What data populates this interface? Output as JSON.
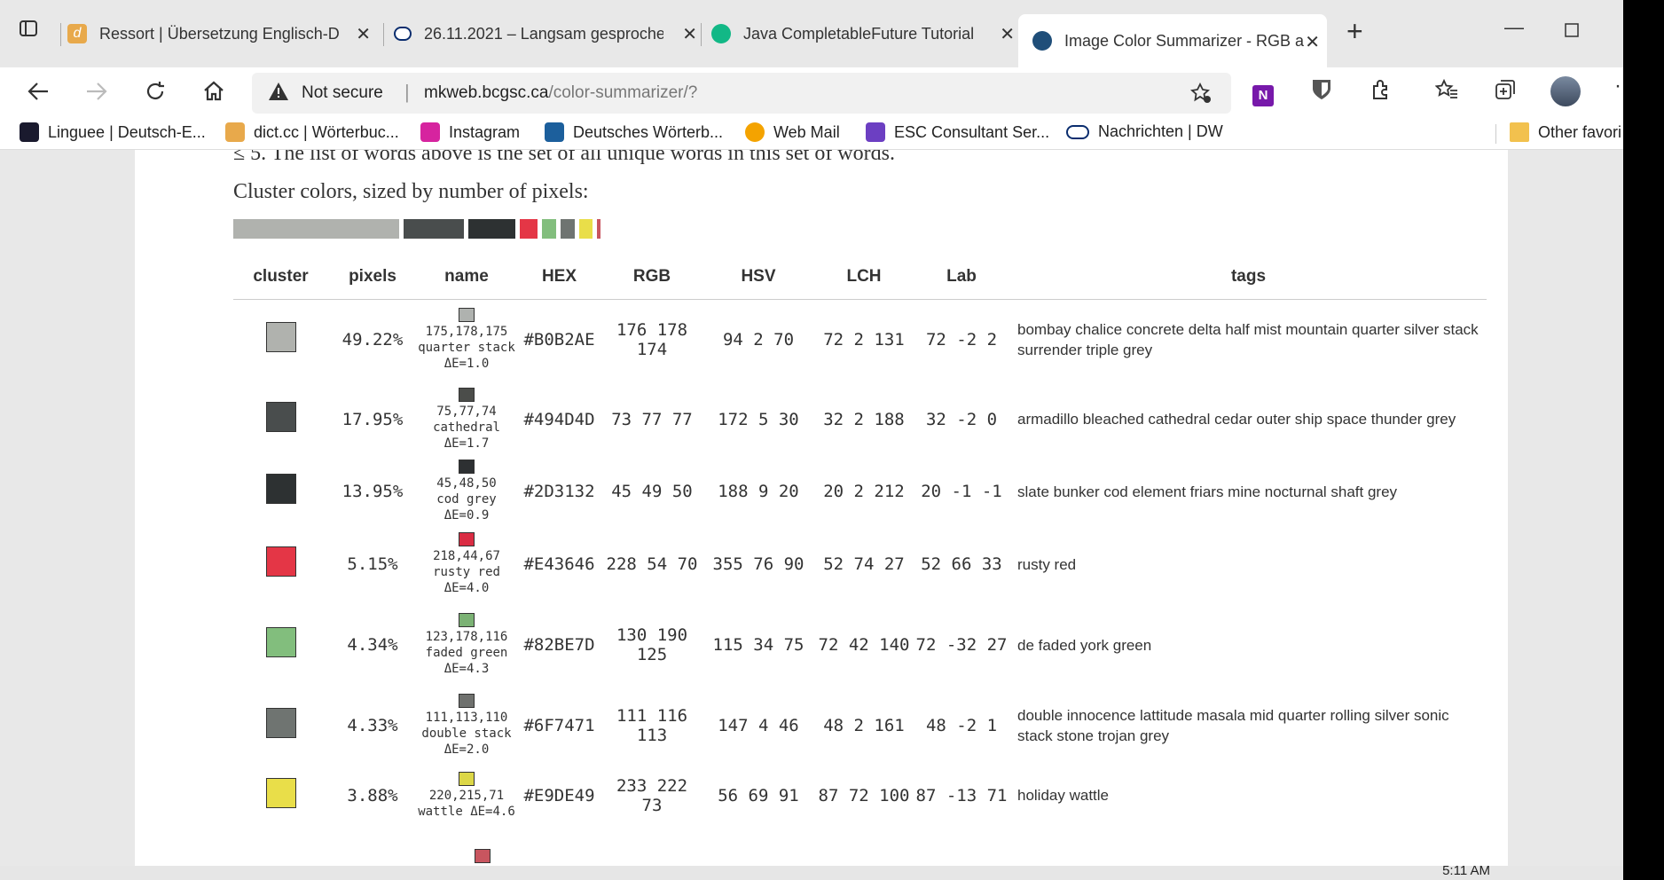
{
  "browser": {
    "tabs": [
      {
        "label": "Ressort | Übersetzung Englisch-D",
        "icon": "dictcc-icon",
        "color": "#e8a94b"
      },
      {
        "label": "26.11.2021 – Langsam gesproche",
        "icon": "dw-icon",
        "color": "#0a2d6e"
      },
      {
        "label": "Java CompletableFuture Tutorial",
        "icon": "grammarly-icon",
        "color": "#12b886"
      },
      {
        "label": "Image Color Summarizer - RGB a",
        "icon": "site-icon",
        "color": "#1f4e79"
      }
    ],
    "address": {
      "security": "Not secure",
      "host": "mkweb.bcgsc.ca",
      "path": "/color-summarizer/?"
    },
    "bookmarks": [
      {
        "label": "Linguee | Deutsch-E...",
        "icon": "linguee-icon",
        "color": "#1a1a2e"
      },
      {
        "label": "dict.cc | Wörterbuc...",
        "icon": "dictcc-icon",
        "color": "#e8a94b"
      },
      {
        "label": "Instagram",
        "icon": "instagram-icon",
        "color": "#d6249f"
      },
      {
        "label": "Deutsches Wörterb...",
        "icon": "dwds-icon",
        "color": "#1c5f9c"
      },
      {
        "label": "Web Mail",
        "icon": "webmail-icon",
        "color": "#f4a300"
      },
      {
        "label": "ESC Consultant Ser...",
        "icon": "form-icon",
        "color": "#6c3fc2"
      },
      {
        "label": "Nachrichten | DW",
        "icon": "dw-icon",
        "color": "#0a2d6e"
      }
    ],
    "other_favorites": "Other favori"
  },
  "page": {
    "intro": "≤ 5. The list of words above is the set of all unique words in this set of words.",
    "cluster_title": "Cluster colors, sized by number of pixels:",
    "cluster_bars": [
      {
        "color": "#B0B2AE",
        "share": 49.22
      },
      {
        "color": "#494D4D",
        "share": 17.95
      },
      {
        "color": "#2D3132",
        "share": 13.95
      },
      {
        "color": "#E43646",
        "share": 5.15
      },
      {
        "color": "#82BE7D",
        "share": 4.34
      },
      {
        "color": "#6F7471",
        "share": 4.33
      },
      {
        "color": "#E9DE49",
        "share": 3.88
      },
      {
        "color": "#C8555F",
        "share": 1.0
      }
    ],
    "table": {
      "headers": [
        "cluster",
        "pixels",
        "name",
        "HEX",
        "RGB",
        "HSV",
        "LCH",
        "Lab",
        "tags"
      ],
      "rows": [
        {
          "color": "#B0B2AE",
          "pixels": "49.22%",
          "name_rgb": "175,178,175",
          "name_text": "quarter stack",
          "delta": "ΔE=1.0",
          "name_color": "#AFB2AF",
          "hex": "#B0B2AE",
          "rgb": "176 178 174",
          "hsv": "94 2 70",
          "lch": "72 2 131",
          "lab": "72 -2 2",
          "tags": "bombay chalice concrete delta half mist mountain quarter silver stack surrender triple grey"
        },
        {
          "color": "#494D4D",
          "pixels": "17.95%",
          "name_rgb": "75,77,74",
          "name_text": "cathedral",
          "delta": "ΔE=1.7",
          "name_color": "#4B4D4A",
          "hex": "#494D4D",
          "rgb": "73 77 77",
          "hsv": "172 5 30",
          "lch": "32 2 188",
          "lab": "32 -2 0",
          "tags": "armadillo bleached cathedral cedar outer ship space thunder grey"
        },
        {
          "color": "#2D3132",
          "pixels": "13.95%",
          "name_rgb": "45,48,50",
          "name_text": "cod grey ΔE=0.9",
          "delta": "",
          "name_color": "#2D3032",
          "hex": "#2D3132",
          "rgb": "45 49 50",
          "hsv": "188 9 20",
          "lch": "20 2 212",
          "lab": "20 -1 -1",
          "tags": "slate bunker cod element friars mine nocturnal shaft grey"
        },
        {
          "color": "#E43646",
          "pixels": "5.15%",
          "name_rgb": "218,44,67",
          "name_text": "rusty red",
          "delta": "ΔE=4.0",
          "name_color": "#DA2C43",
          "hex": "#E43646",
          "rgb": "228 54 70",
          "hsv": "355 76 90",
          "lch": "52 74 27",
          "lab": "52 66 33",
          "tags": "rusty red"
        },
        {
          "color": "#82BE7D",
          "pixels": "4.34%",
          "name_rgb": "123,178,116",
          "name_text": "faded green",
          "delta": "ΔE=4.3",
          "name_color": "#7BB274",
          "hex": "#82BE7D",
          "rgb": "130 190 125",
          "hsv": "115 34 75",
          "lch": "72 42 140",
          "lab": "72 -32 27",
          "tags": "de faded york green"
        },
        {
          "color": "#6F7471",
          "pixels": "4.33%",
          "name_rgb": "111,113,110",
          "name_text": "double stack",
          "delta": "ΔE=2.0",
          "name_color": "#6F716E",
          "hex": "#6F7471",
          "rgb": "111 116 113",
          "hsv": "147 4 46",
          "lch": "48 2 161",
          "lab": "48 -2 1",
          "tags": "double innocence lattitude masala mid quarter rolling silver sonic stack stone trojan grey"
        },
        {
          "color": "#E9DE49",
          "pixels": "3.88%",
          "name_rgb": "220,215,71",
          "name_text": "wattle ΔE=4.6",
          "delta": "",
          "name_color": "#DCD747",
          "hex": "#E9DE49",
          "rgb": "233 222 73",
          "hsv": "56 69 91",
          "lch": "87 72 100",
          "lab": "87 -13 71",
          "tags": "holiday wattle"
        }
      ]
    }
  },
  "taskbar": {
    "clock": "5:11 AM"
  }
}
